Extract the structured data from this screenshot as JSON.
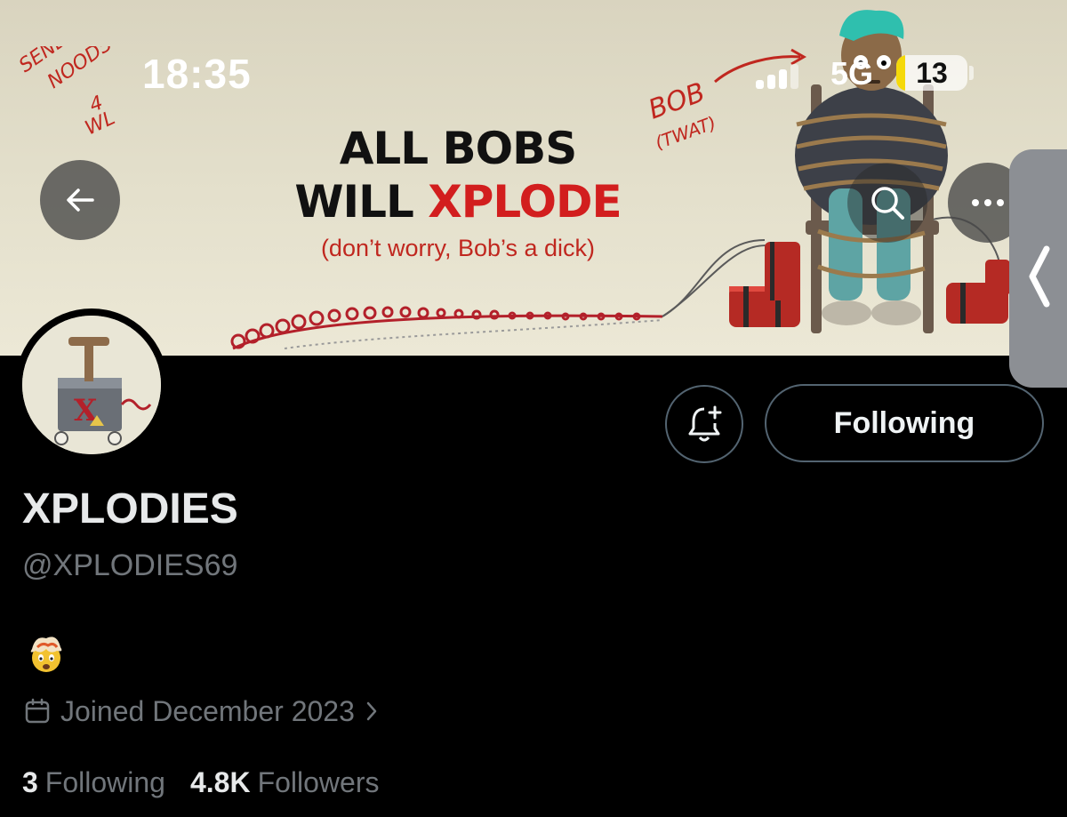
{
  "status_bar": {
    "time": "18:35",
    "network": "5G",
    "battery_level": "13",
    "battery_fraction": 0.13
  },
  "banner": {
    "headline_line1": "ALL BOBS",
    "headline_line2_a": "WILL ",
    "headline_line2_b": "XPLODE",
    "subtitle": "(don’t worry, Bob’s a dick)",
    "handwritten_left": [
      "SEND",
      "NOODS",
      "4",
      "WL"
    ],
    "handwritten_right": [
      "BOB",
      "(TWAT)"
    ]
  },
  "nav": {
    "back_icon": "arrow-left-icon",
    "search_icon": "search-icon",
    "more_icon": "more-horizontal-icon"
  },
  "profile": {
    "display_name": "XPLODIES",
    "handle": "@XPLODIES69",
    "bio_emoji": "🤯",
    "joined": "Joined December 2023",
    "following_button": "Following",
    "following_count": "3",
    "following_label": "Following",
    "followers_count": "4.8K",
    "followers_label": "Followers"
  },
  "colors": {
    "background": "#000000",
    "text_primary": "#e7e9ea",
    "text_secondary": "#71767b",
    "button_border": "#536471",
    "headline_red": "#d21e1e",
    "battery_fill": "#f5d90a"
  }
}
